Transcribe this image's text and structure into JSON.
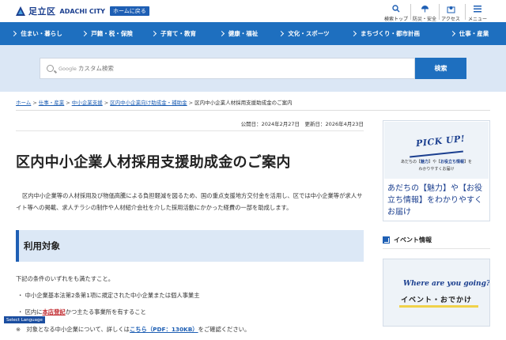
{
  "header": {
    "logo_ja": "足立区",
    "logo_en": "ADACHI CITY",
    "home_button": "ホームに戻る",
    "utilities": [
      {
        "label": "検索トップ",
        "icon": "search-icon"
      },
      {
        "label": "防災・安全",
        "icon": "umbrella-icon"
      },
      {
        "label": "アクセス",
        "icon": "map-pin-icon"
      },
      {
        "label": "メニュー",
        "icon": "menu-icon"
      }
    ]
  },
  "nav": {
    "items": [
      "住まい・暮らし",
      "戸籍・税・保険",
      "子育て・教育",
      "健康・福祉",
      "文化・スポーツ",
      "まちづくり・都市計画",
      "仕事・産業"
    ]
  },
  "search": {
    "google_label": "Google",
    "placeholder": "カスタム検索",
    "button": "検索"
  },
  "breadcrumb": {
    "links": [
      "ホーム",
      "仕事・産業",
      "中小企業支援",
      "区内中小企業向け助成金・補助金"
    ],
    "current": "区内中小企業人材採用支援助成金のご案内"
  },
  "article": {
    "dates": "公開日：2024年2月27日　更新日：2026年4月23日",
    "title": "区内中小企業人材採用支援助成金のご案内",
    "intro": "区内中小企業等の人材採用及び物価高騰による負担軽減を図るため、国の重点支援地方交付金を活用し、区では中小企業等が求人サイト等への掲載、求人チラシの制作や人材紹介会社を介した採用活動にかかった経費の一部を助成します。",
    "section_title": "利用対象",
    "conditions_lead": "下記の条件のいずれをも満たすこと。",
    "condition_1": "・ 中小企業基本法第2条第1項に規定された中小企業または個人事業主",
    "condition_2_pre": "・ 区内に",
    "condition_2_link": "本店登記",
    "condition_2_post": "かつ主たる事業所を有すること",
    "note_pre": "※　対象となる中小企業について、詳しくは",
    "note_link": "こちら（PDF：130KB）",
    "note_post": "をご確認ください。"
  },
  "language_button": "Select Language",
  "sidebar": {
    "pick_title": "PICK UP!",
    "pick_sub_line1_a": "あだちの【",
    "pick_sub_line1_b": "魅力",
    "pick_sub_line1_c": "】や【",
    "pick_sub_line1_d": "お役立ち情報",
    "pick_sub_line1_e": "】を",
    "pick_sub_line2": "わかりやすくお届け",
    "pick_text": "あだちの【魅力】や【お役立ち情報】をわかりやすくお届け",
    "event_heading": "イベント情報",
    "event_where": "Where are you going?",
    "event_title": "イベント・おでかけ"
  },
  "colors": {
    "brand_blue": "#1e6fbf",
    "dark_blue": "#1b3f8f",
    "search_band": "#dbe7f5",
    "link_red": "#c0282d"
  }
}
